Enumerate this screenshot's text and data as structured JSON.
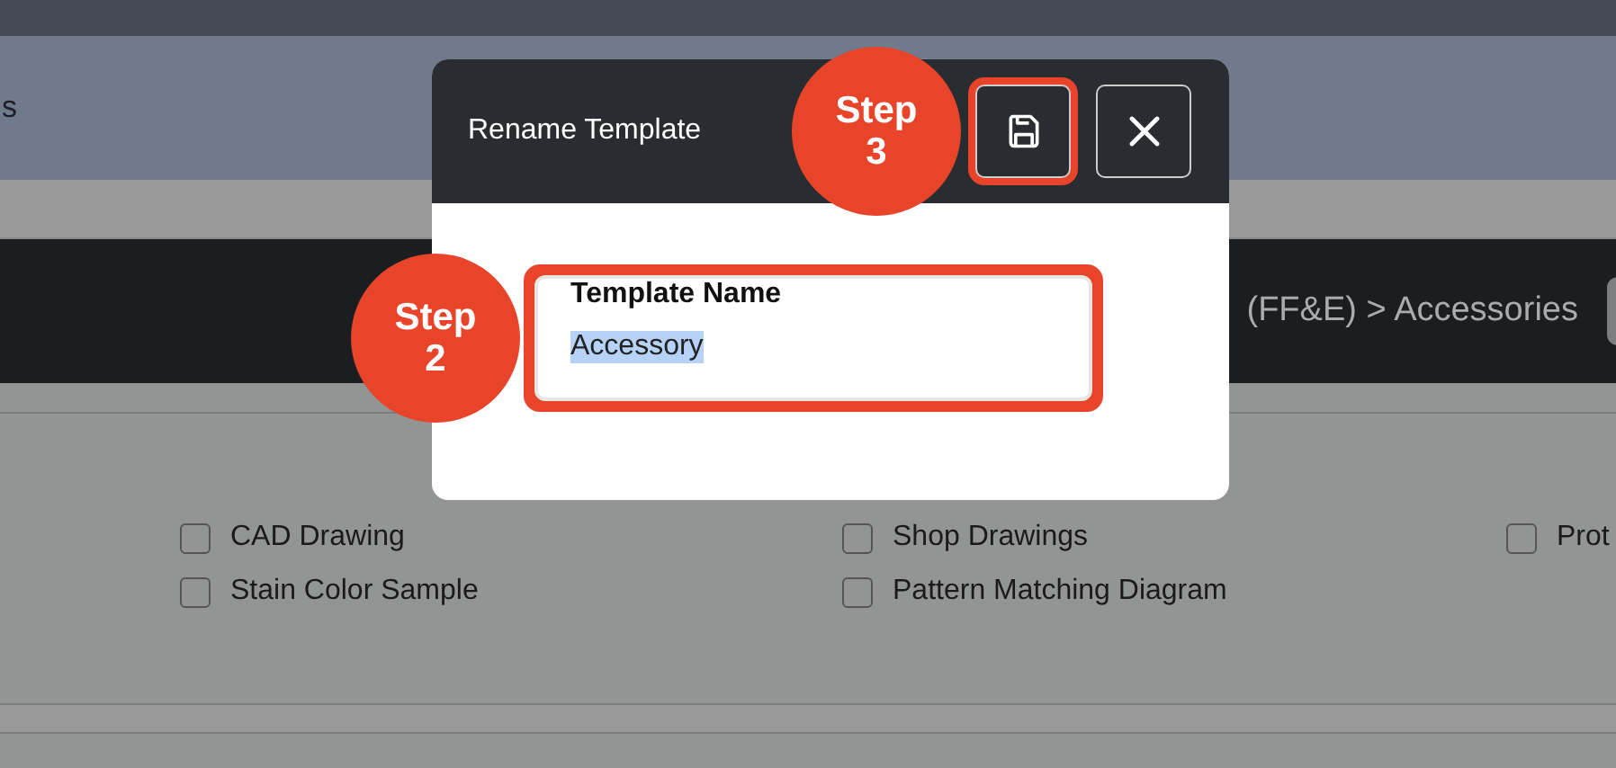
{
  "page": {
    "heading_fragment": "s",
    "breadcrumb": "(FF&E) > Accessories",
    "checkboxes": [
      {
        "label": "CAD Drawing",
        "checked": false
      },
      {
        "label": "Shop Drawings",
        "checked": false
      },
      {
        "label": "Prot",
        "checked": false
      },
      {
        "label": "Stain Color Sample",
        "checked": false
      },
      {
        "label": "Pattern Matching Diagram",
        "checked": false
      }
    ]
  },
  "dialog": {
    "title": "Rename Template",
    "buttons": [
      {
        "kind": "save",
        "highlighted": true
      },
      {
        "kind": "close",
        "highlighted": false
      }
    ],
    "field": {
      "label": "Template Name",
      "value": "Accessory",
      "value_selected": true,
      "highlighted": true
    }
  },
  "steps": [
    {
      "label": "Step",
      "number": "2"
    },
    {
      "label": "Step",
      "number": "3"
    }
  ]
}
